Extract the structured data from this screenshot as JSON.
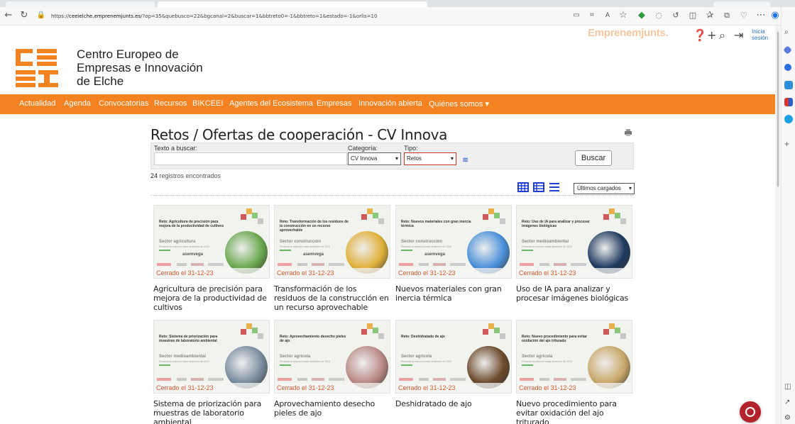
{
  "browser": {
    "url_prefix": "https://",
    "url_host": "ceeielche.emprenemjunts.es",
    "url_rest": "/?op=35&quebusco=22&bgcanal=2&buscar=1&bbtreto0=-1&bbtreto=1&estado=-1&orlis=10",
    "back_icon": "arrow-left-icon",
    "reload_icon": "reload-icon",
    "more_icon": "ellipsis-icon"
  },
  "header": {
    "brand": "Emprenemjunts.",
    "login_label_1": "Inicia",
    "login_label_2": "sesión",
    "org_name_line1": "Centro Europeo de",
    "org_name_line2": "Empresas e Innovación",
    "org_name_line3": "de Elche"
  },
  "nav": {
    "items": [
      "Actualidad",
      "Agenda",
      "Convocatorias",
      "Recursos",
      "BIKCEEI",
      "Agentes del Ecosistema",
      "Empresas",
      "Innovación abierta",
      "Quiénes somos ▾"
    ]
  },
  "main": {
    "title": "Retos / Ofertas de cooperación - CV Innova",
    "filters": {
      "text_label": "Texto a buscar:",
      "text_value": "",
      "category_label": "Categoría:",
      "category_value": "CV Innova",
      "type_label": "Tipo:",
      "type_value": "Retos",
      "search_button": "Buscar"
    },
    "count_number": "24",
    "count_text": " registros encontrados",
    "sort_value": "Últimos cargados"
  },
  "colors": {
    "accent": "#f58220",
    "closed_text": "#d2582a",
    "link_blue": "#1e4fd6"
  },
  "cards": [
    {
      "thumb_title": "Reto: Agricultura de precisión para mejora de la productividad de cultivos",
      "sector": "Sector agricultura",
      "subline": "Presenta tu solución hasta diciembre de 2023",
      "logo": "asemvega",
      "status": "Cerrado el 31-12-23",
      "title": "Agricultura de precisión para mejora de la productividad de cultivos",
      "circle": "#6aa84f"
    },
    {
      "thumb_title": "Reto: Transformación de los residuos de la construcción en un recurso aprovechable",
      "sector": "Sector construcción",
      "subline": "Presenta tu solución hasta diciembre de 2023",
      "logo": "asemvega",
      "status": "Cerrado el 31-12-23",
      "title": "Transformación de los residuos de la construcción en un recurso aprovechable",
      "circle": "#e0b13a"
    },
    {
      "thumb_title": "Reto: Nuevos materiales con gran inercia térmica",
      "sector": "Sector construcción",
      "subline": "Presenta tu solución hasta diciembre de 2023",
      "logo": "asemvega",
      "status": "Cerrado el 31-12-23",
      "title": "Nuevos materiales con gran inercia térmica",
      "circle": "#4a90d9"
    },
    {
      "thumb_title": "Reto: Uso de IA para analizar y procesar imágenes biológicas",
      "sector": "Sector medioambiental",
      "subline": "Presenta tu solución hasta diciembre de 2023",
      "logo": "",
      "status": "Cerrado el 31-12-23",
      "title": "Uso de IA para analizar y procesar imágenes biológicas",
      "circle": "#1f3a5f"
    },
    {
      "thumb_title": "Reto: Sistema de priorización para muestras de laboratorio ambiental",
      "sector": "Sector medioambiental",
      "subline": "Presenta tu solución hasta diciembre de 2023",
      "logo": "",
      "status": "Cerrado el 31-12-23",
      "title": "Sistema de priorización para muestras de laboratorio ambiental",
      "circle": "#7a8ca0"
    },
    {
      "thumb_title": "Reto: Aprovechamiento desecho pieles de ajo",
      "sector": "Sector agrícola",
      "subline": "Presenta tu solución hasta diciembre de 2023",
      "logo": "",
      "status": "Cerrado el 31-12-23",
      "title": "Aprovechamiento desecho pieles de ajo",
      "circle": "#b98a86"
    },
    {
      "thumb_title": "Reto: Deshidratado de ajo",
      "sector": "Sector agrícola",
      "subline": "Presenta tu solución hasta diciembre de 2023",
      "logo": "",
      "status": "Cerrado el 31-12-23",
      "title": "Deshidratado de ajo",
      "circle": "#6b4a2b"
    },
    {
      "thumb_title": "Reto: Nuevo procedimiento para evitar oxidación del ajo triturado",
      "sector": "Sector agrícola",
      "subline": "Presenta tu solución hasta diciembre de 2023",
      "logo": "",
      "status": "Cerrado el 31-12-23",
      "title": "Nuevo procedimiento para evitar oxidación del ajo triturado",
      "circle": "#c9a86a"
    }
  ]
}
